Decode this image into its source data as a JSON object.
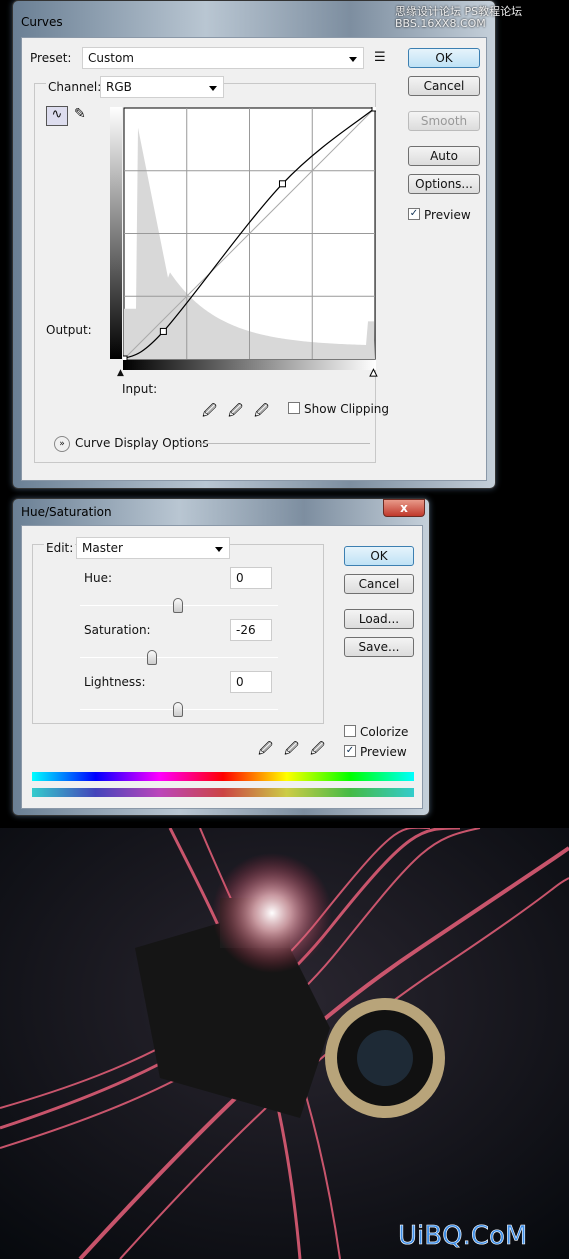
{
  "curves": {
    "title": "Curves",
    "preset_label": "Preset:",
    "preset_value": "Custom",
    "channel_label": "Channel:",
    "channel_value": "RGB",
    "buttons": {
      "ok": "OK",
      "cancel": "Cancel",
      "smooth": "Smooth",
      "auto": "Auto",
      "options": "Options..."
    },
    "preview_label": "Preview",
    "preview_checked": true,
    "output_label": "Output:",
    "input_label": "Input:",
    "show_clipping_label": "Show Clipping",
    "show_clipping_checked": false,
    "display_options_label": "Curve Display Options",
    "curve_points": [
      [
        0,
        0
      ],
      [
        40,
        28
      ],
      [
        161,
        178
      ],
      [
        255,
        255
      ]
    ]
  },
  "hue_saturation": {
    "title": "Hue/Saturation",
    "close_label": "x",
    "edit_label": "Edit:",
    "edit_value": "Master",
    "hue_label": "Hue:",
    "hue_value": "0",
    "saturation_label": "Saturation:",
    "saturation_value": "-26",
    "lightness_label": "Lightness:",
    "lightness_value": "0",
    "buttons": {
      "ok": "OK",
      "cancel": "Cancel",
      "load": "Load...",
      "save": "Save..."
    },
    "colorize_label": "Colorize",
    "colorize_checked": false,
    "preview_label": "Preview",
    "preview_checked": true
  },
  "watermark_top": "思缘设计论坛 PS教程论坛 BBS.16XX8.COM",
  "watermark_bottom": "UiBQ.CoM"
}
